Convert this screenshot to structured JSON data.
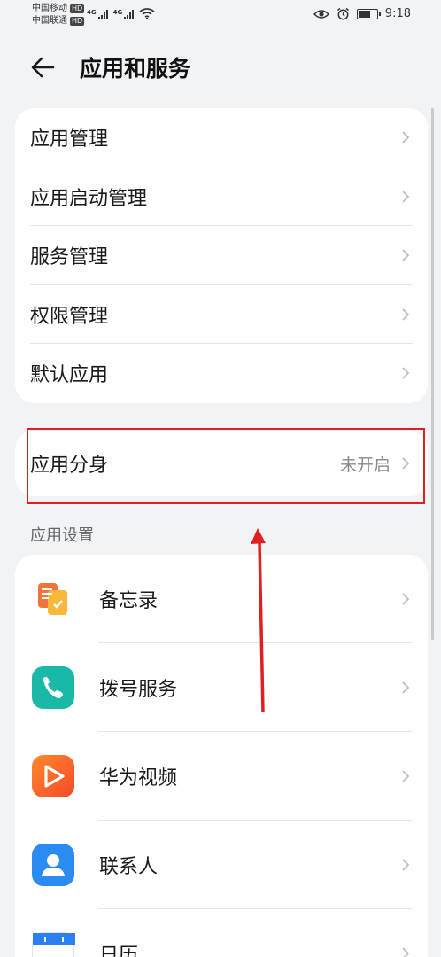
{
  "status_bar": {
    "carrier1": "中国移动",
    "carrier2": "中国联通",
    "hd": "HD",
    "network1": "4G",
    "network2": "4G",
    "time": "9:18"
  },
  "header": {
    "title": "应用和服务"
  },
  "menu": [
    {
      "label": "应用管理"
    },
    {
      "label": "应用启动管理"
    },
    {
      "label": "服务管理"
    },
    {
      "label": "权限管理"
    },
    {
      "label": "默认应用"
    }
  ],
  "clone": {
    "label": "应用分身",
    "value": "未开启"
  },
  "section_app_settings": "应用设置",
  "apps": [
    {
      "label": "备忘录",
      "icon": "memo-icon",
      "color": "#f7a13a"
    },
    {
      "label": "拨号服务",
      "icon": "phone-icon",
      "color": "#18b9a6"
    },
    {
      "label": "华为视频",
      "icon": "video-icon",
      "color": "#f7652a"
    },
    {
      "label": "联系人",
      "icon": "contacts-icon",
      "color": "#2a8cf2"
    },
    {
      "label": "日历",
      "icon": "calendar-icon",
      "color": "#2a7ff2"
    }
  ],
  "colors": {
    "highlight": "#e02020",
    "background": "#f1f3f5"
  }
}
